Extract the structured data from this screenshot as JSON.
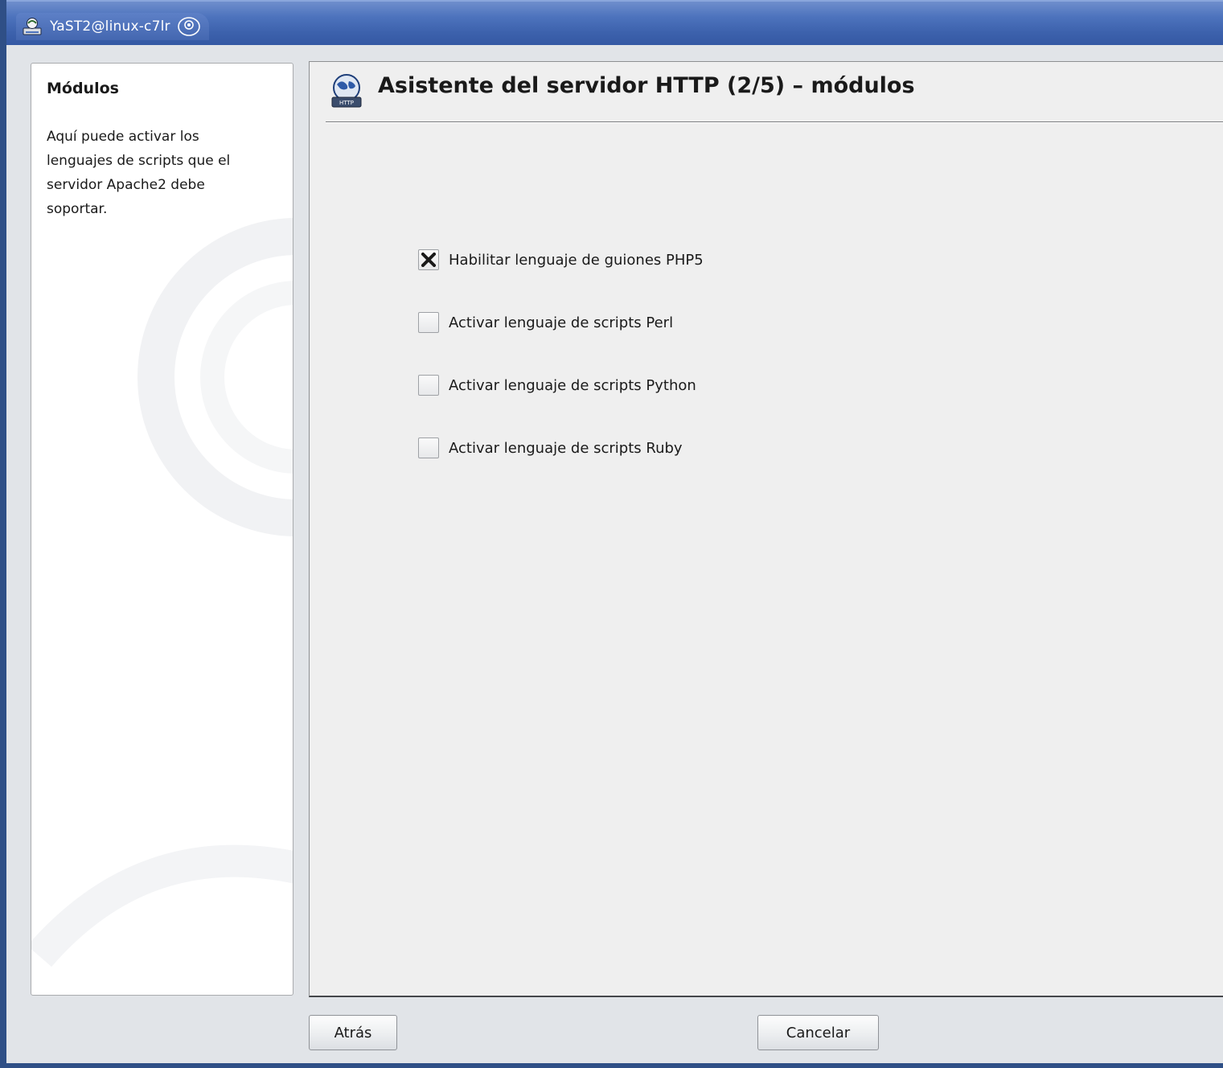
{
  "window": {
    "title": "YaST2@linux-c7lr"
  },
  "help": {
    "title": "Módulos",
    "text": "Aquí puede activar los lenguajes de scripts que el servidor Apache2 debe soportar."
  },
  "wizard": {
    "title": "Asistente del servidor HTTP (2/5) – módulos",
    "icon": "http-server-globe-icon",
    "options": [
      {
        "label": "Habilitar lenguaje de guiones PHP5",
        "checked": true
      },
      {
        "label": "Activar lenguaje de scripts Perl",
        "checked": false
      },
      {
        "label": "Activar lenguaje de scripts Python",
        "checked": false
      },
      {
        "label": "Activar lenguaje de scripts Ruby",
        "checked": false
      }
    ]
  },
  "buttons": {
    "back": "Atrás",
    "cancel": "Cancelar"
  },
  "colors": {
    "titlebar": "#4d73bd",
    "window_frame": "#2f4f86",
    "client_background": "#e1e4e8",
    "panel_background": "#efefef"
  }
}
